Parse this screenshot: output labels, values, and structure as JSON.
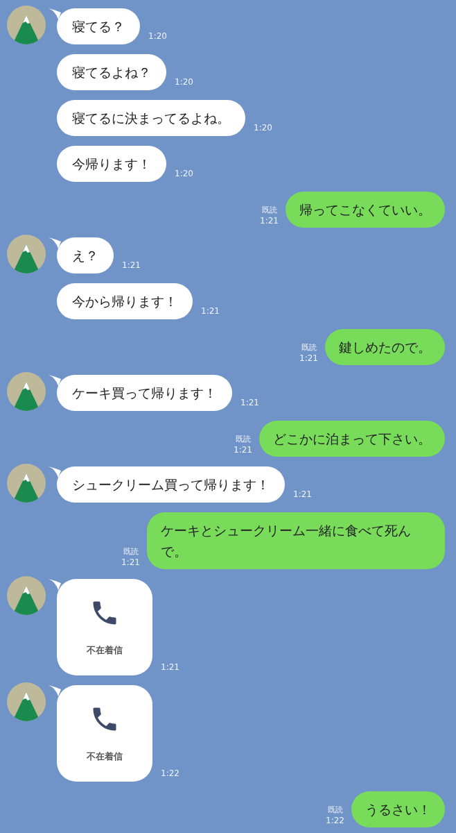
{
  "messages": [
    {
      "kind": "incoming",
      "avatar": true,
      "text": "寝てる？",
      "time": "1:20"
    },
    {
      "kind": "incoming",
      "avatar": false,
      "text": "寝てるよね？",
      "time": "1:20"
    },
    {
      "kind": "incoming",
      "avatar": false,
      "text": "寝てるに決まってるよね。",
      "time": "1:20"
    },
    {
      "kind": "incoming",
      "avatar": false,
      "text": "今帰ります！",
      "time": "1:20"
    },
    {
      "kind": "outgoing",
      "read_label": "既読",
      "text": "帰ってこなくていい。",
      "time": "1:21"
    },
    {
      "kind": "incoming",
      "avatar": true,
      "text": "え？",
      "time": "1:21"
    },
    {
      "kind": "incoming",
      "avatar": false,
      "text": "今から帰ります！",
      "time": "1:21"
    },
    {
      "kind": "outgoing",
      "read_label": "既読",
      "text": "鍵しめたので。",
      "time": "1:21"
    },
    {
      "kind": "incoming",
      "avatar": true,
      "text": "ケーキ買って帰ります！",
      "time": "1:21"
    },
    {
      "kind": "outgoing",
      "read_label": "既読",
      "text": "どこかに泊まって下さい。",
      "time": "1:21"
    },
    {
      "kind": "incoming",
      "avatar": true,
      "text": "シュークリーム買って帰ります！",
      "time": "1:21"
    },
    {
      "kind": "outgoing",
      "read_label": "既読",
      "text": "ケーキとシュークリーム一緒に食べて死んで。",
      "time": "1:21"
    },
    {
      "kind": "missed_call",
      "avatar": true,
      "text": "不在着信",
      "time": "1:21"
    },
    {
      "kind": "missed_call",
      "avatar": true,
      "text": "不在着信",
      "time": "1:22"
    },
    {
      "kind": "outgoing",
      "read_label": "既読",
      "text": "うるさい！",
      "time": "1:22"
    }
  ]
}
